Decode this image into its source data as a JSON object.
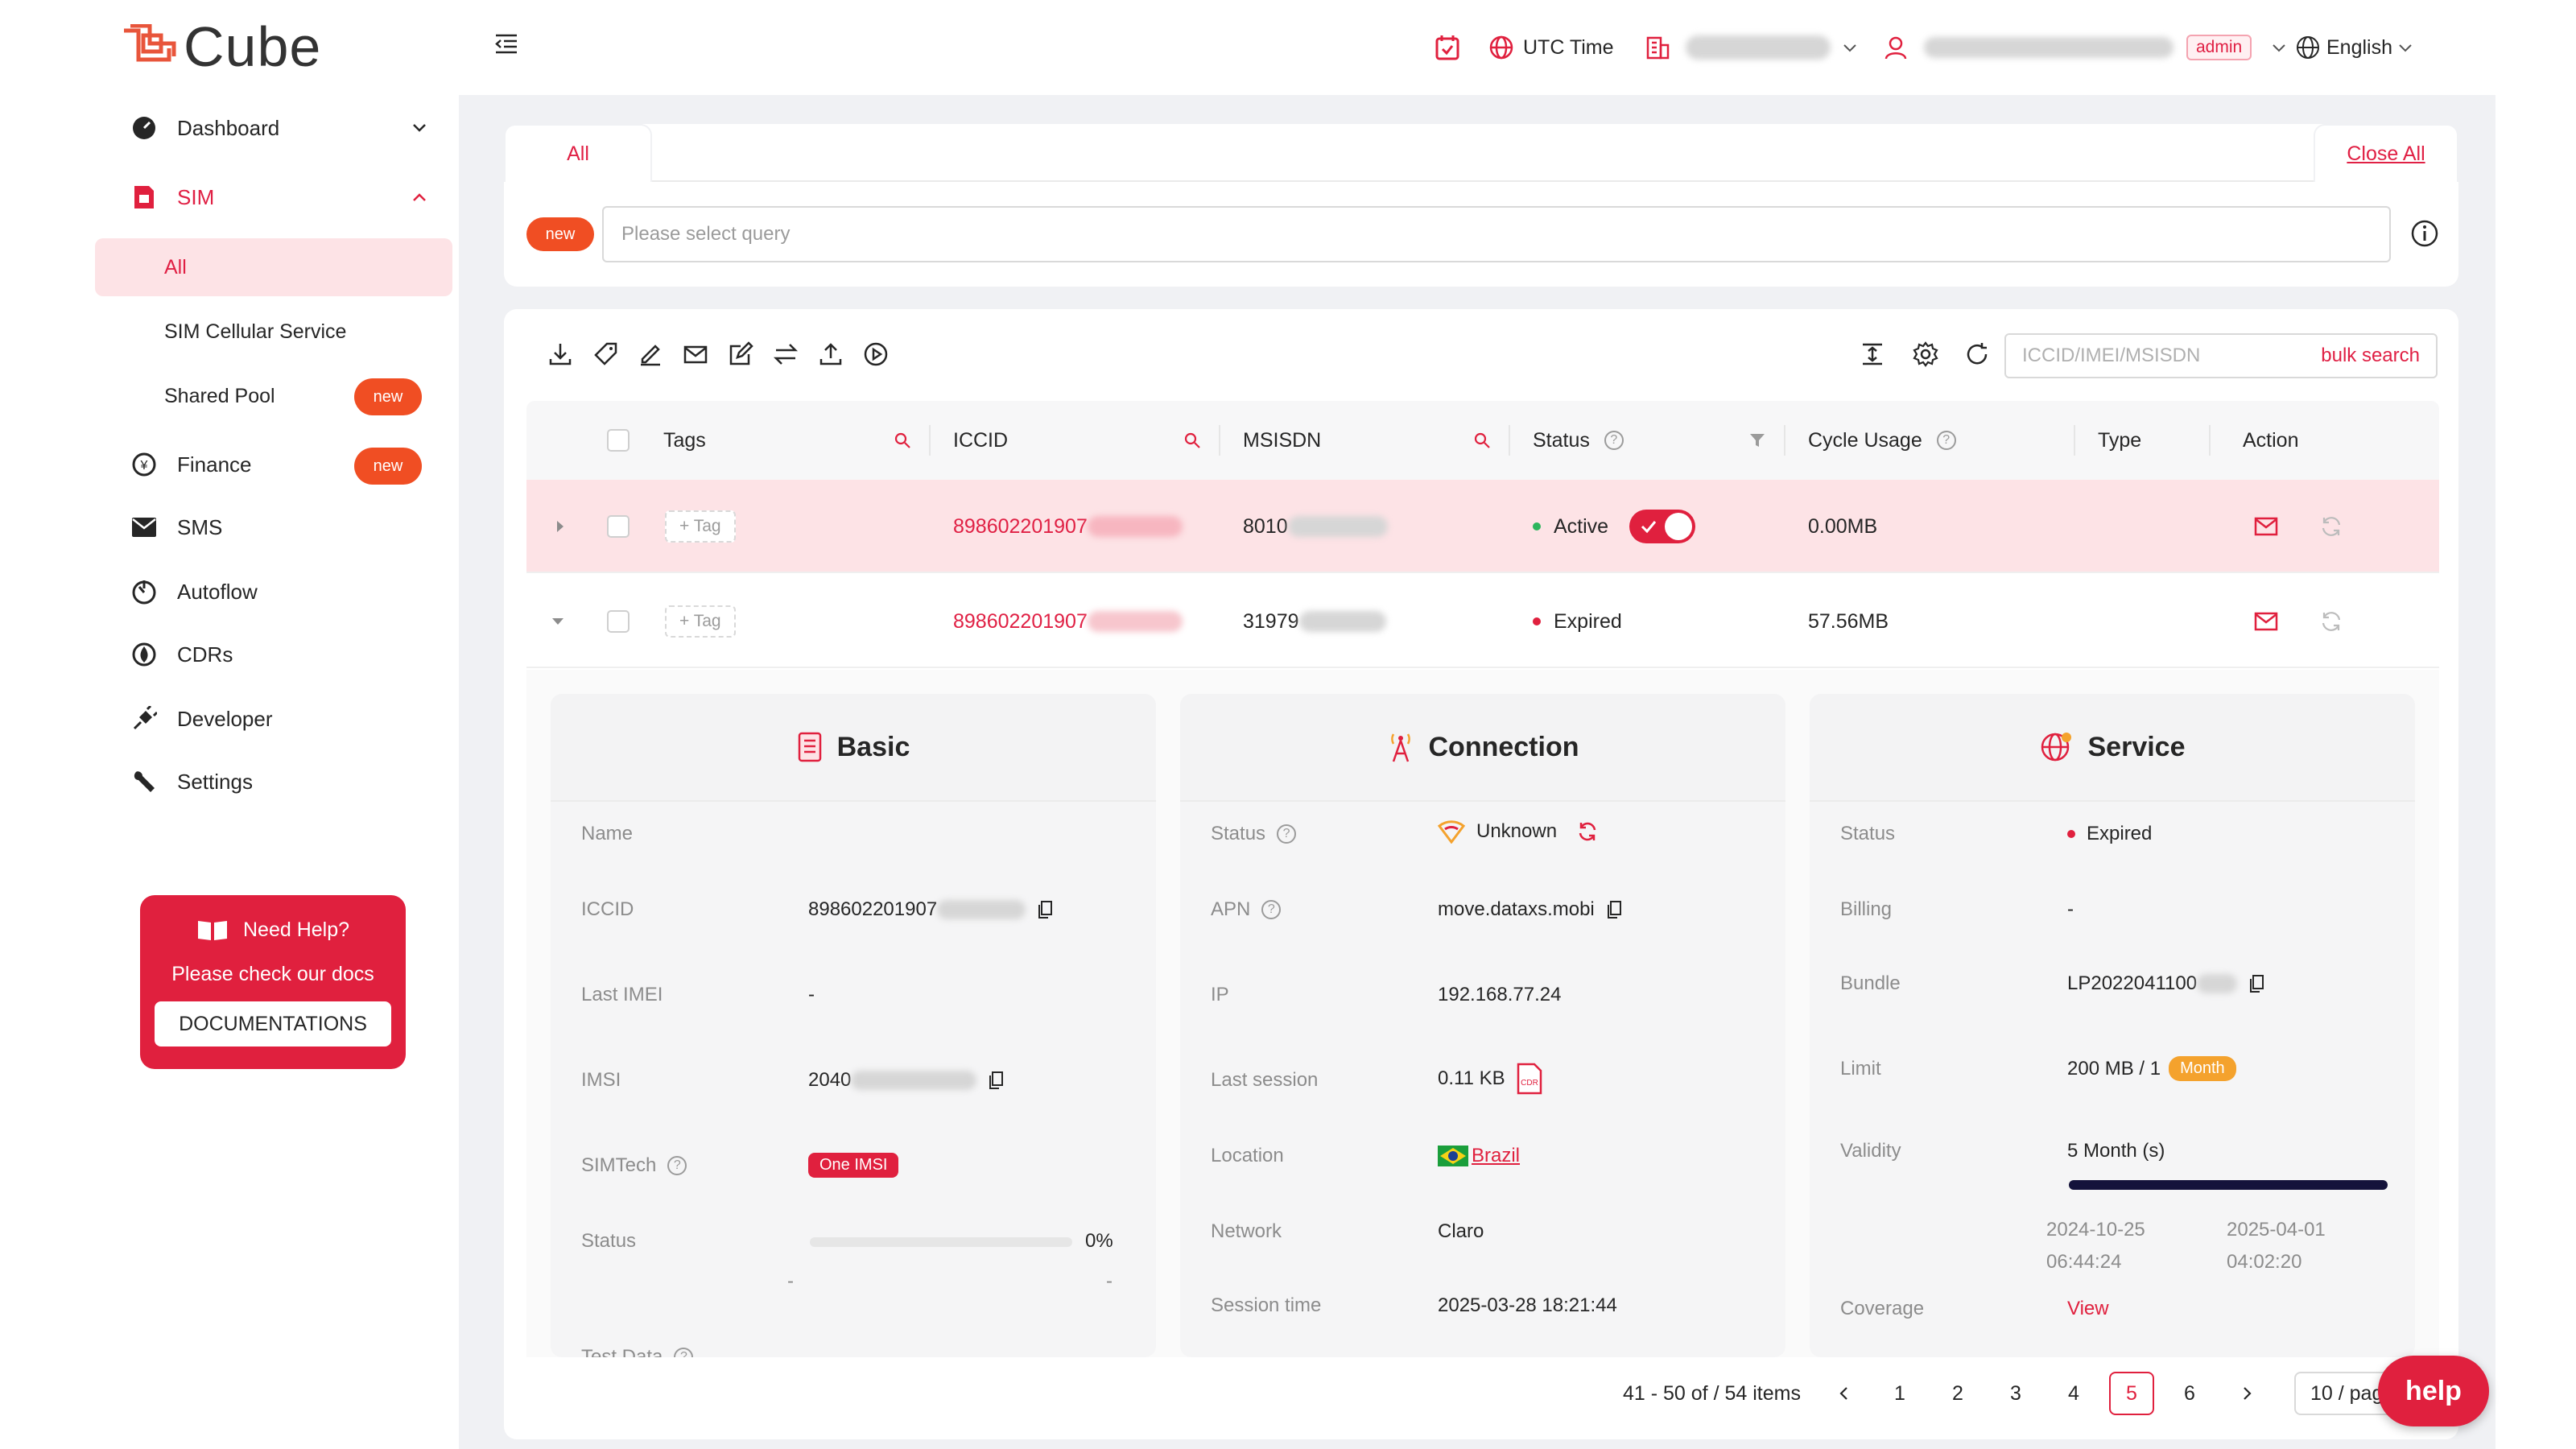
{
  "app": {
    "logo_text": "Cube"
  },
  "sidebar": {
    "dashboard": "Dashboard",
    "sim": "SIM",
    "sim_sub": [
      "All",
      "SIM Cellular Service",
      "Shared Pool"
    ],
    "finance": "Finance",
    "sms": "SMS",
    "autoflow": "Autoflow",
    "cdrs": "CDRs",
    "developer": "Developer",
    "settings": "Settings",
    "new_badge": "new",
    "help_title": "Need Help?",
    "help_text": "Please check our docs",
    "help_button": "DOCUMENTATIONS"
  },
  "header": {
    "timezone": "UTC Time",
    "role_badge": "admin",
    "language": "English"
  },
  "tabs": {
    "active": "All",
    "close_all": "Close All"
  },
  "query": {
    "new_badge": "new",
    "placeholder": "Please select query"
  },
  "toolbar": {
    "search_placeholder": "ICCID/IMEI/MSISDN",
    "bulk_search": "bulk search"
  },
  "table": {
    "columns": [
      "Tags",
      "ICCID",
      "MSISDN",
      "Status",
      "Cycle Usage",
      "Type",
      "Action"
    ],
    "tag_button": "+ Tag",
    "rows": [
      {
        "iccid": "898602201907",
        "msisdn": "8010",
        "status": "Active",
        "usage": "0.00MB"
      },
      {
        "iccid": "898602201907",
        "msisdn": "31979",
        "status": "Expired",
        "usage": "57.56MB"
      }
    ]
  },
  "basic": {
    "title": "Basic",
    "labels": [
      "Name",
      "ICCID",
      "Last IMEI",
      "IMSI",
      "SIMTech",
      "Status",
      "Test Data"
    ],
    "iccid": "898602201907",
    "last_imei": "-",
    "imsi": "2040",
    "simtech": "One IMSI",
    "status_percent": "0%",
    "dash_left": "-",
    "dash_right": "-"
  },
  "connection": {
    "title": "Connection",
    "labels": [
      "Status",
      "APN",
      "IP",
      "Last session",
      "Location",
      "Network",
      "Session time"
    ],
    "status": "Unknown",
    "apn": "move.dataxs.mobi",
    "ip": "192.168.77.24",
    "last_session": "0.11 KB",
    "location": "Brazil",
    "network": "Claro",
    "session_time": "2025-03-28 18:21:44"
  },
  "service": {
    "title": "Service",
    "labels": [
      "Status",
      "Billing",
      "Bundle",
      "Limit",
      "Validity",
      "Coverage"
    ],
    "status": "Expired",
    "billing": "-",
    "bundle": "LP2022041100",
    "limit": "200 MB / 1",
    "limit_unit": "Month",
    "validity": "5 Month (s)",
    "validity_progress": 1.0,
    "start_date": "2024-10-25",
    "start_time": "06:44:24",
    "end_date": "2025-04-01",
    "end_time": "04:02:20",
    "coverage": "View"
  },
  "pagination": {
    "summary": "41 - 50 of / 54 items",
    "pages": [
      "1",
      "2",
      "3",
      "4",
      "5",
      "6"
    ],
    "current": "5",
    "page_size": "10 / pag"
  },
  "help_button": "help",
  "colors": {
    "accent": "#e0203e",
    "badge_orange": "#f04e23",
    "active_green": "#2db55d"
  }
}
